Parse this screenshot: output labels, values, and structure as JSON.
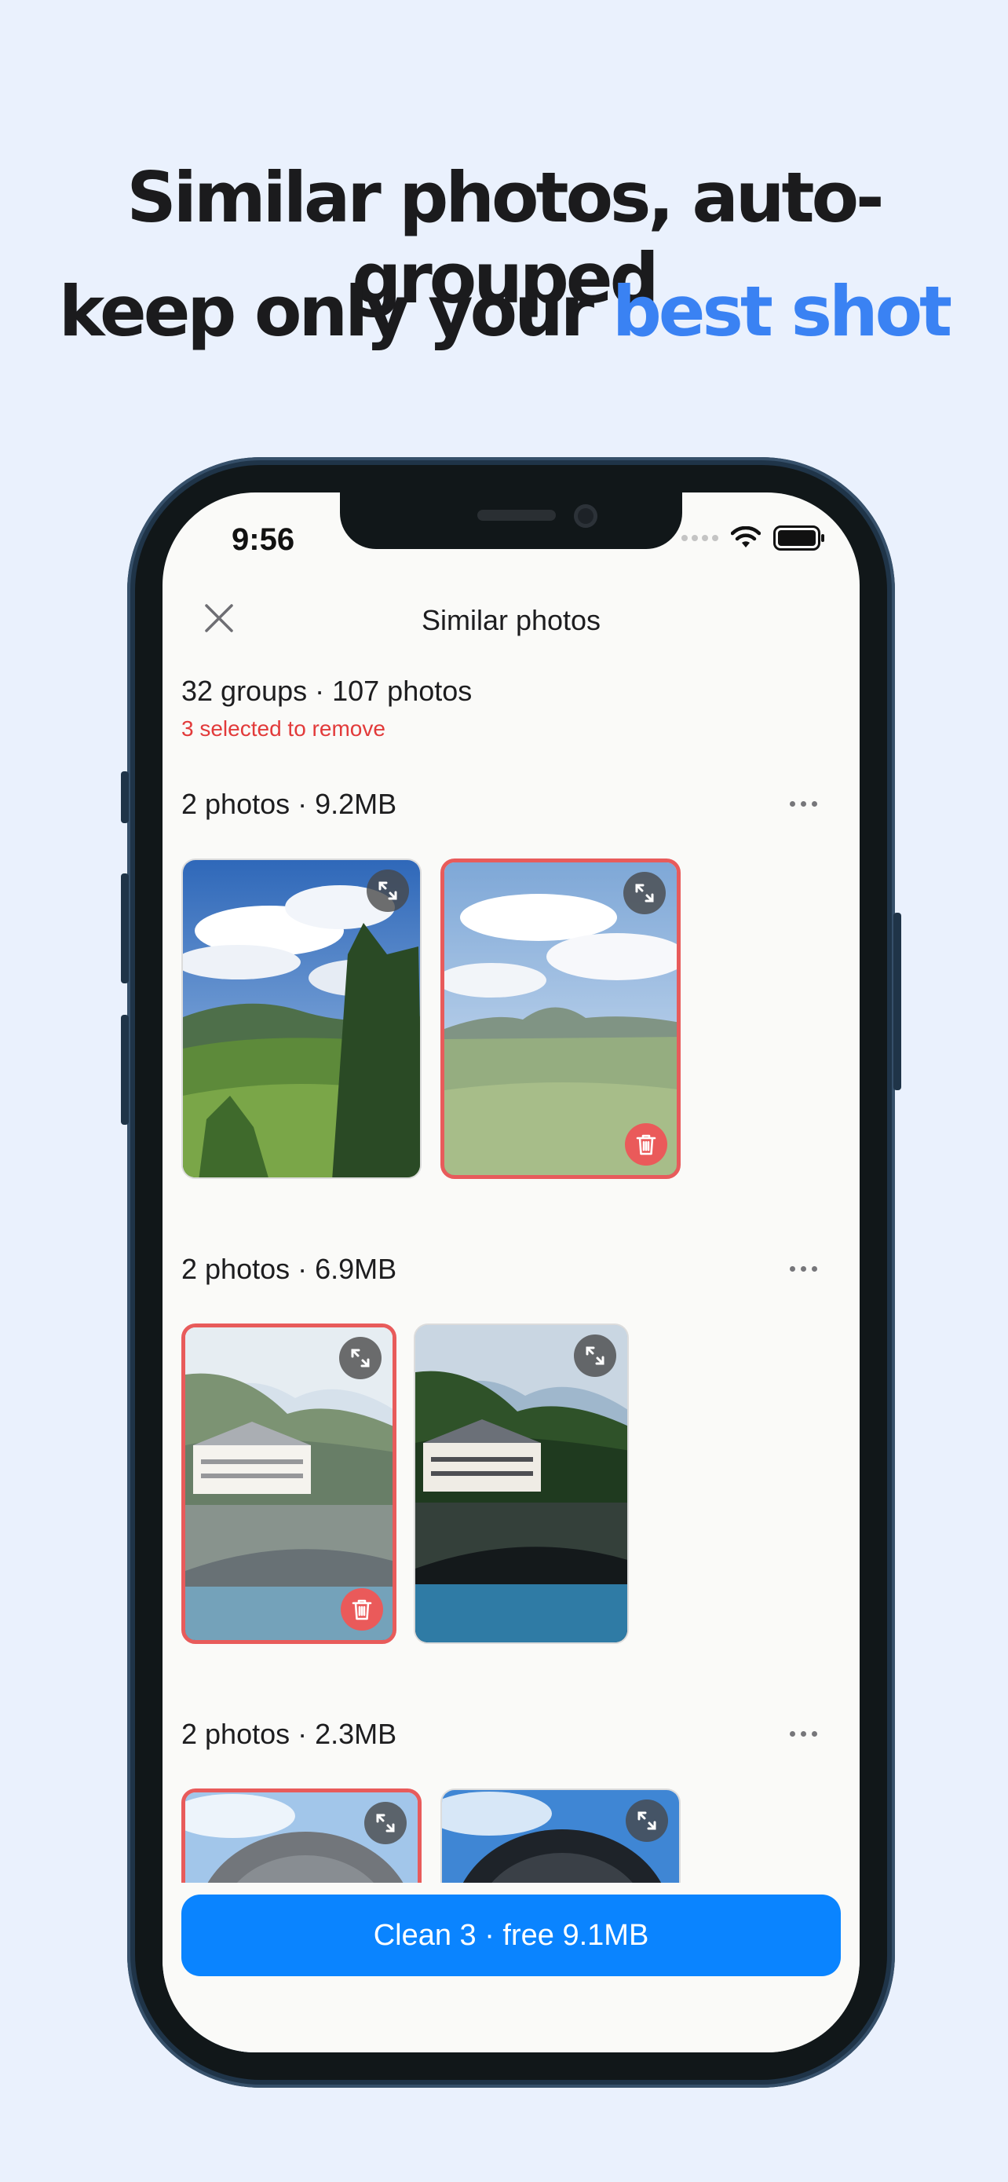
{
  "headline": {
    "line1": "Similar photos, auto-grouped",
    "line2_prefix": "keep only your ",
    "line2_accent": "best shot",
    "accent_color": "#3a82f3"
  },
  "status_bar": {
    "time": "9:56",
    "icons": [
      "cellular-dots-icon",
      "wifi-icon",
      "battery-icon"
    ]
  },
  "nav": {
    "title": "Similar photos",
    "close_icon": "close-icon"
  },
  "summary": {
    "text": "32 groups · 107 photos",
    "selected_note": "3 selected to remove",
    "selected_color": "#e23a3a"
  },
  "groups": [
    {
      "header": "2 photos · 9.2MB",
      "photos": [
        {
          "scene": "forest-sky",
          "selected": false
        },
        {
          "scene": "meadow-hills",
          "selected": true
        }
      ]
    },
    {
      "header": "2 photos · 6.9MB",
      "photos": [
        {
          "scene": "lake-building",
          "selected": true
        },
        {
          "scene": "lake-building",
          "selected": false
        }
      ]
    },
    {
      "header": "2 photos · 2.3MB",
      "photos": [
        {
          "scene": "dome-sky",
          "selected": true
        },
        {
          "scene": "dome-sky",
          "selected": false
        }
      ]
    }
  ],
  "action": {
    "label": "Clean 3 · free 9.1MB",
    "color": "#0a84ff"
  }
}
